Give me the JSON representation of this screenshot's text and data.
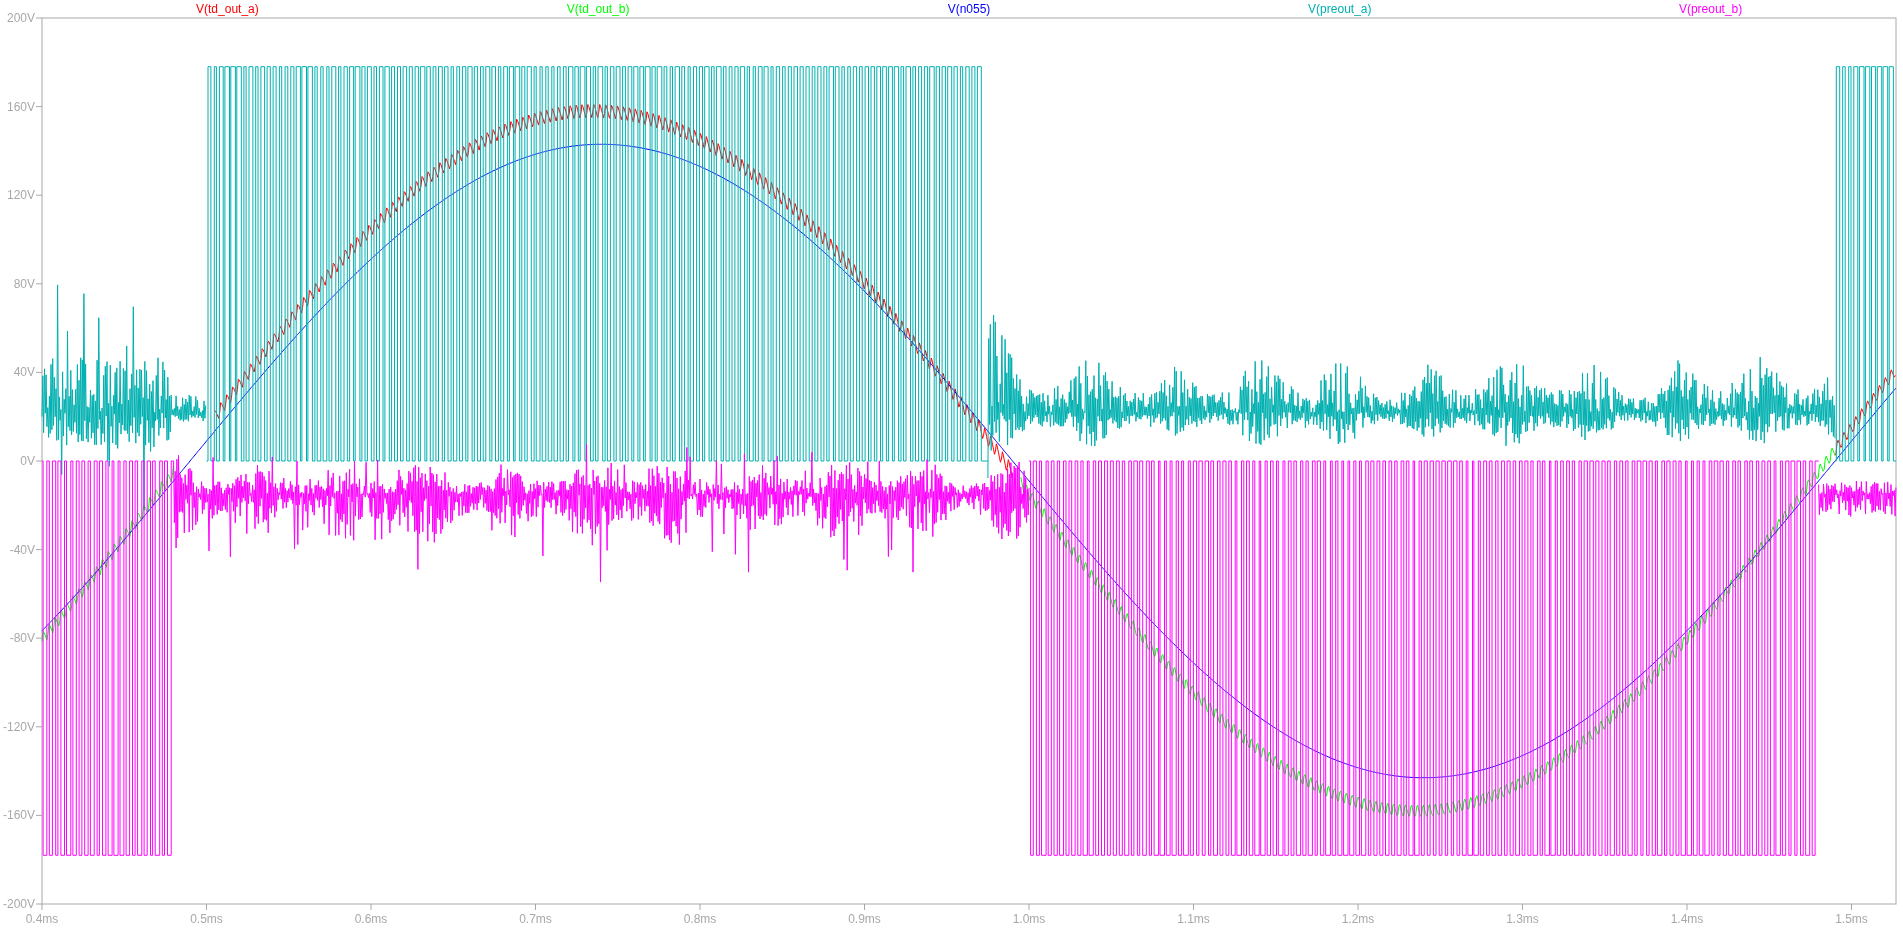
{
  "plot": {
    "traces": [
      {
        "label": "V(td_out_a)",
        "color": "#ff0000"
      },
      {
        "label": "V(td_out_b)",
        "color": "#00ff00"
      },
      {
        "label": "V(n055)",
        "color": "#0000ff"
      },
      {
        "label": "V(preout_a)",
        "color": "#00b0b0"
      },
      {
        "label": "V(preout_b)",
        "color": "#ff00ff"
      }
    ],
    "y_ticks": [
      "200V",
      "160V",
      "120V",
      "80V",
      "40V",
      "0V",
      "-40V",
      "-80V",
      "-120V",
      "-160V",
      "-200V"
    ],
    "x_ticks": [
      "0.4ms",
      "0.5ms",
      "0.6ms",
      "0.7ms",
      "0.8ms",
      "0.9ms",
      "1.0ms",
      "1.1ms",
      "1.2ms",
      "1.3ms",
      "1.4ms",
      "1.5ms"
    ]
  }
}
